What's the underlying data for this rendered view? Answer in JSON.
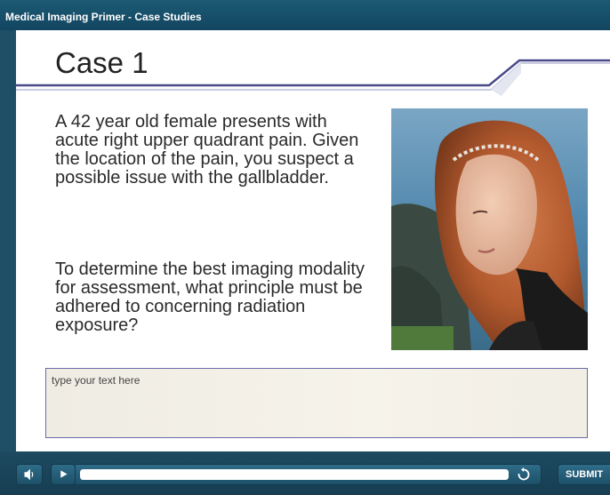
{
  "app": {
    "title": "Medical Imaging Primer - Case Studies"
  },
  "slide": {
    "title": "Case 1",
    "paragraph1": "A 42 year old female presents with acute right upper quadrant pain. Given the location of the pain, you suspect a possible issue with the gallbladder.",
    "paragraph2": "To determine the best imaging modality for assessment, what principle must be adhered to concerning radiation exposure?",
    "image_alt": "Photo of a red-haired woman looking to the side"
  },
  "answer": {
    "placeholder": "type your text here",
    "value": ""
  },
  "player": {
    "submit_label": "SUBMIT",
    "progress": 1.0,
    "volume_icon": "speaker-icon",
    "play_icon": "play-icon",
    "replay_icon": "replay-icon"
  },
  "colors": {
    "frame": "#1f4f66",
    "accent_line": "#4a4a8a",
    "answer_border": "#6a6aa8"
  }
}
